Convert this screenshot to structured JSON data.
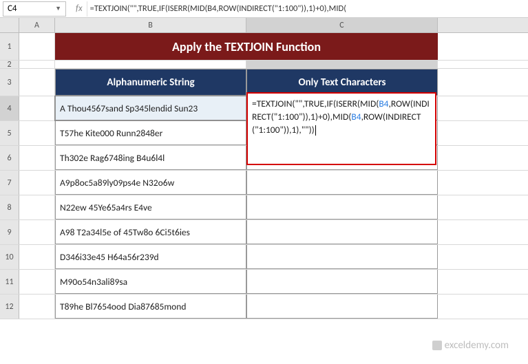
{
  "namebox": {
    "value": "C4"
  },
  "formula_bar": {
    "text": "=TEXTJOIN(\"\",TRUE,IF(ISERR(MID(B4,ROW(INDIRECT(\"1:100\")),1)+0),MID("
  },
  "columns": {
    "A": "A",
    "B": "B",
    "C": "C"
  },
  "rows": [
    "1",
    "2",
    "3",
    "4",
    "5",
    "6",
    "7",
    "8",
    "9",
    "10",
    "11",
    "12"
  ],
  "title": "Apply the TEXTJOIN Function",
  "headers": {
    "B": "Alphanumeric String",
    "C": "Only Text Characters"
  },
  "data": {
    "B4": "A Thou4567sand Sp345lendid Sun23",
    "B5": "T57he Kite000 Runn2848er",
    "B6": "Th302e Rag6748ing B4u6l4l",
    "B7": "A9p8oc5a89ly09ps4e N32o6w",
    "B8": "N22ew 45Ye65a4rs E4ve",
    "B9": "A98 T2a34l5e of 45Tw8o 6Ci5t6ies",
    "B10": "D346i33e45 H64a56r239d",
    "B11": "M90o54n3ali89sa",
    "B12": "T89he Bl7654ood Dia87685mond"
  },
  "formula_edit": {
    "p1": "=TEXTJOIN(\"\",TRUE,IF(ISERR(MID(",
    "ref1": "B4",
    "p2": ",ROW(INDIRECT(\"1:100\")),1)+0),MID(",
    "ref2": "B4",
    "p3": ",ROW(INDIRECT(\"1:100\")),1),\"\"))"
  },
  "watermark": "exceldemy.com"
}
